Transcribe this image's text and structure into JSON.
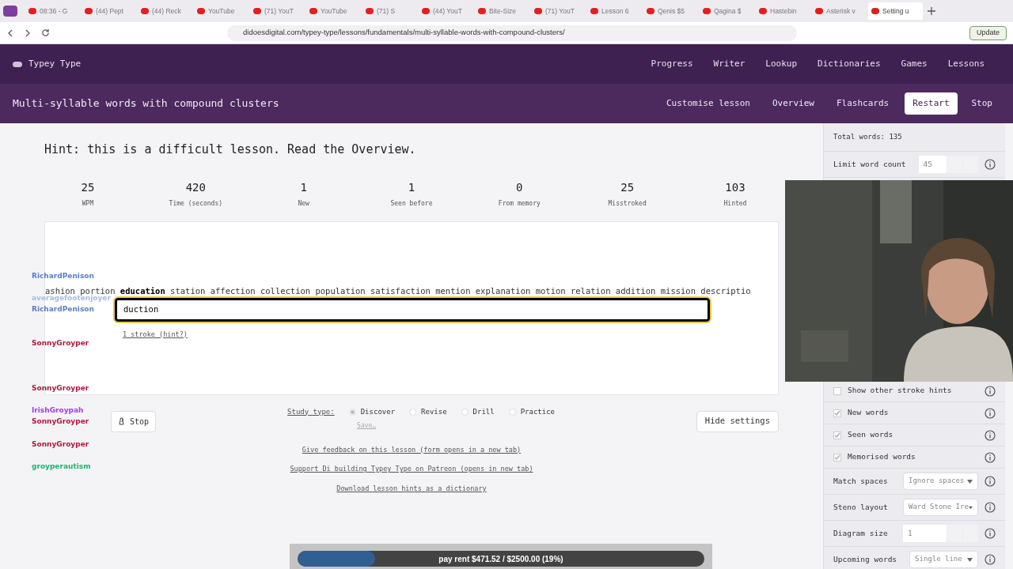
{
  "browser": {
    "tabs": [
      {
        "title": "08:36 - G",
        "selected": false
      },
      {
        "title": "(44) Pept",
        "selected": false
      },
      {
        "title": "(44) Reck",
        "selected": false
      },
      {
        "title": "YouTube",
        "selected": false
      },
      {
        "title": "(71) YouT",
        "selected": false
      },
      {
        "title": "YouTube",
        "selected": false
      },
      {
        "title": "(71) S",
        "selected": false
      },
      {
        "title": "(44) YouT",
        "selected": false
      },
      {
        "title": "Bite-Size",
        "selected": false
      },
      {
        "title": "(71) YouT",
        "selected": false
      },
      {
        "title": "Lesson 6",
        "selected": false
      },
      {
        "title": "Qenis $5",
        "selected": false
      },
      {
        "title": "Qagina $",
        "selected": false
      },
      {
        "title": "Hastebin",
        "selected": false
      },
      {
        "title": "Asterisk v",
        "selected": false
      },
      {
        "title": "Setting u",
        "selected": true
      }
    ],
    "url": "didoesdigital.com/typey-type/lessons/fundamentals/multi-syllable-words-with-compound-clusters/",
    "update_button": "Update"
  },
  "site": {
    "logo": "Typey Type",
    "nav": [
      "Progress",
      "Writer",
      "Lookup",
      "Dictionaries",
      "Games",
      "Lessons"
    ]
  },
  "lesson": {
    "title": "Multi-syllable words with compound clusters",
    "links": [
      "Customise lesson",
      "Overview",
      "Flashcards"
    ],
    "buttons": [
      {
        "label": "Restart",
        "primary": true
      },
      {
        "label": "Stop",
        "primary": false
      }
    ]
  },
  "hint": "Hint: this is a difficult lesson. Read the Overview.",
  "stats": [
    {
      "value": "25",
      "label": "WPM"
    },
    {
      "value": "420",
      "label": "Time (seconds)"
    },
    {
      "value": "1",
      "label": "New"
    },
    {
      "value": "1",
      "label": "Seen before"
    },
    {
      "value": "0",
      "label": "From memory"
    },
    {
      "value": "25",
      "label": "Misstroked"
    },
    {
      "value": "103",
      "label": "Hinted"
    }
  ],
  "material": [
    {
      "word": "ashion",
      "current": false
    },
    {
      "word": "portion",
      "current": false
    },
    {
      "word": "education",
      "current": true
    },
    {
      "word": "station",
      "current": false
    },
    {
      "word": "affection",
      "current": false
    },
    {
      "word": "collection",
      "current": false
    },
    {
      "word": "population",
      "current": false
    },
    {
      "word": "satisfaction",
      "current": false
    },
    {
      "word": "mention",
      "current": false
    },
    {
      "word": "explanation",
      "current": false
    },
    {
      "word": "motion",
      "current": false
    },
    {
      "word": "relation",
      "current": false
    },
    {
      "word": "addition",
      "current": false
    },
    {
      "word": "mission",
      "current": false
    },
    {
      "word": "descriptio",
      "current": false
    }
  ],
  "typed": "duction",
  "stroke_hint": "1 stroke (hint?)",
  "stop_button": "Stop",
  "study_type": {
    "label": "Study type:",
    "options": [
      {
        "label": "Discover",
        "selected": true
      },
      {
        "label": "Revise",
        "selected": false
      },
      {
        "label": "Drill",
        "selected": false
      },
      {
        "label": "Practice",
        "selected": false
      }
    ],
    "save": "Save…"
  },
  "hide_settings": "Hide settings",
  "footer_links": [
    "Give feedback on this lesson (form opens in a new tab)",
    "Support Di building Typey Type on Patreon (opens in new tab)",
    "Download lesson hints as a dictionary"
  ],
  "settings": {
    "total_words": "Total words: 135",
    "rows": [
      {
        "kind": "number",
        "label": "Limit word count",
        "value": "45"
      },
      {
        "kind": "checkbox",
        "label": "Show other stroke hints",
        "checked": false
      },
      {
        "kind": "checkbox",
        "label": "New words",
        "checked": true
      },
      {
        "kind": "checkbox",
        "label": "Seen words",
        "checked": true
      },
      {
        "kind": "checkbox",
        "label": "Memorised words",
        "checked": true
      },
      {
        "kind": "select",
        "label": "Match spaces",
        "value": "Ignore spaces"
      },
      {
        "kind": "select",
        "label": "Steno layout",
        "value": "Ward Stone Ire"
      },
      {
        "kind": "number",
        "label": "Diagram size",
        "value": "1"
      },
      {
        "kind": "select",
        "label": "Upcoming words",
        "value": "Single line"
      }
    ]
  },
  "chat": [
    {
      "kind": "faint"
    },
    {
      "kind": "faint"
    },
    {
      "kind": "name",
      "name": "RichardPenison",
      "color": "#5b7fc7"
    },
    {
      "kind": "faint"
    },
    {
      "kind": "name",
      "name": "averagefootenjoyer",
      "color": "#a9bbe0"
    },
    {
      "kind": "name",
      "name": "RichardPenison",
      "color": "#5b7fc7"
    },
    {
      "kind": "faint"
    },
    {
      "kind": "faint"
    },
    {
      "kind": "name",
      "name": "SonnyGroyper",
      "color": "#b5173d"
    },
    {
      "kind": "faint"
    },
    {
      "kind": "faint"
    },
    {
      "kind": "faint"
    },
    {
      "kind": "name",
      "name": "SonnyGroyper",
      "color": "#b5173d"
    },
    {
      "kind": "faint"
    },
    {
      "kind": "name",
      "name": "IrishGroypah",
      "color": "#a040e0"
    },
    {
      "kind": "name",
      "name": "SonnyGroyper",
      "color": "#b5173d"
    },
    {
      "kind": "faint"
    },
    {
      "kind": "name",
      "name": "SonnyGroyper",
      "color": "#b5173d"
    },
    {
      "kind": "faint"
    },
    {
      "kind": "name",
      "name": "groyperautism",
      "color": "#1fb36b"
    }
  ],
  "goal": {
    "text": "pay rent $471.52 / $2500.00 (19%)",
    "level": 0.19
  }
}
